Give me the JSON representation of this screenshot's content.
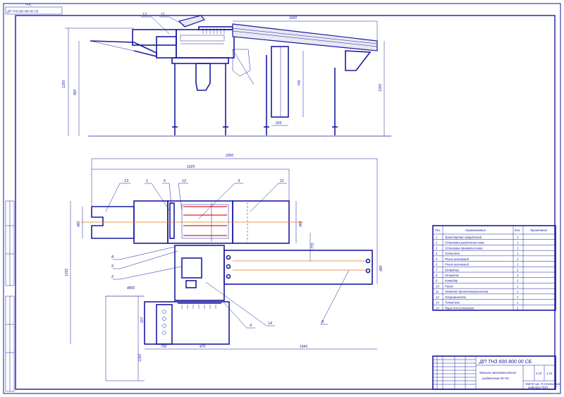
{
  "stamp": {
    "code": "ДП ТНЗ 600 800 00 СБ"
  },
  "sheet": {
    "corner_text": "ЧПС"
  },
  "side_view": {
    "callouts": [
      "12",
      "11"
    ],
    "dims": {
      "top_length": "1600",
      "h1": "1200",
      "h2": "860",
      "h3": "1000",
      "h4": "740",
      "w1": "265"
    }
  },
  "plan_view": {
    "callouts": [
      "13",
      "1",
      "6",
      "12",
      "3",
      "11",
      "8",
      "5",
      "2",
      "4",
      "14",
      "9"
    ],
    "dims": {
      "overall": "2300",
      "main": "1625",
      "w_left": "480",
      "w_right": "480",
      "mid": "770",
      "h_total": "1035",
      "conv": "480",
      "pit_w": "4800",
      "pit_h": "207",
      "pit_depth": "1050",
      "b1": "700",
      "b2": "470",
      "b3": "1945"
    }
  },
  "spec_table": {
    "headers": [
      "Поз.",
      "Наименование",
      "Кол.",
      "Примечание"
    ],
    "rows": [
      {
        "pos": "1",
        "name": "Транспортер загрузочный",
        "qty": "1"
      },
      {
        "pos": "2",
        "name": "Установка разделения кожи",
        "qty": "1"
      },
      {
        "pos": "3",
        "name": "Установка прижатия кожи",
        "qty": "1"
      },
      {
        "pos": "4",
        "name": "Толкатель",
        "qty": "1"
      },
      {
        "pos": "5",
        "name": "Ролик резиновый",
        "qty": "1"
      },
      {
        "pos": "6",
        "name": "Ролик резиновый",
        "qty": "1"
      },
      {
        "pos": "7",
        "name": "Отводчик",
        "qty": "2"
      },
      {
        "pos": "8",
        "name": "Отводчик",
        "qty": "2"
      },
      {
        "pos": "9",
        "name": "Конвейер",
        "qty": "1"
      },
      {
        "pos": "10",
        "name": "Ролик",
        "qty": "1"
      },
      {
        "pos": "11",
        "name": "Элемент фотоэлектрический",
        "qty": "1"
      },
      {
        "pos": "12",
        "name": "Опорожнитель",
        "qty": "1"
      },
      {
        "pos": "13",
        "name": "Толкатель",
        "qty": "1"
      },
      {
        "pos": "14",
        "name": "Ящик для шпикового",
        "qty": "1"
      }
    ]
  },
  "title_block": {
    "code": "ДП ТНЗ 600 800 00 СБ",
    "name_line1": "Машина автоматическая",
    "name_line2": "разделочная 30-Ч/1",
    "mass": "4.10",
    "scale": "1:10",
    "org_line1": "ОмГАУ им. П.Столыпина",
    "org_line2": "Кафедра ПОП"
  }
}
